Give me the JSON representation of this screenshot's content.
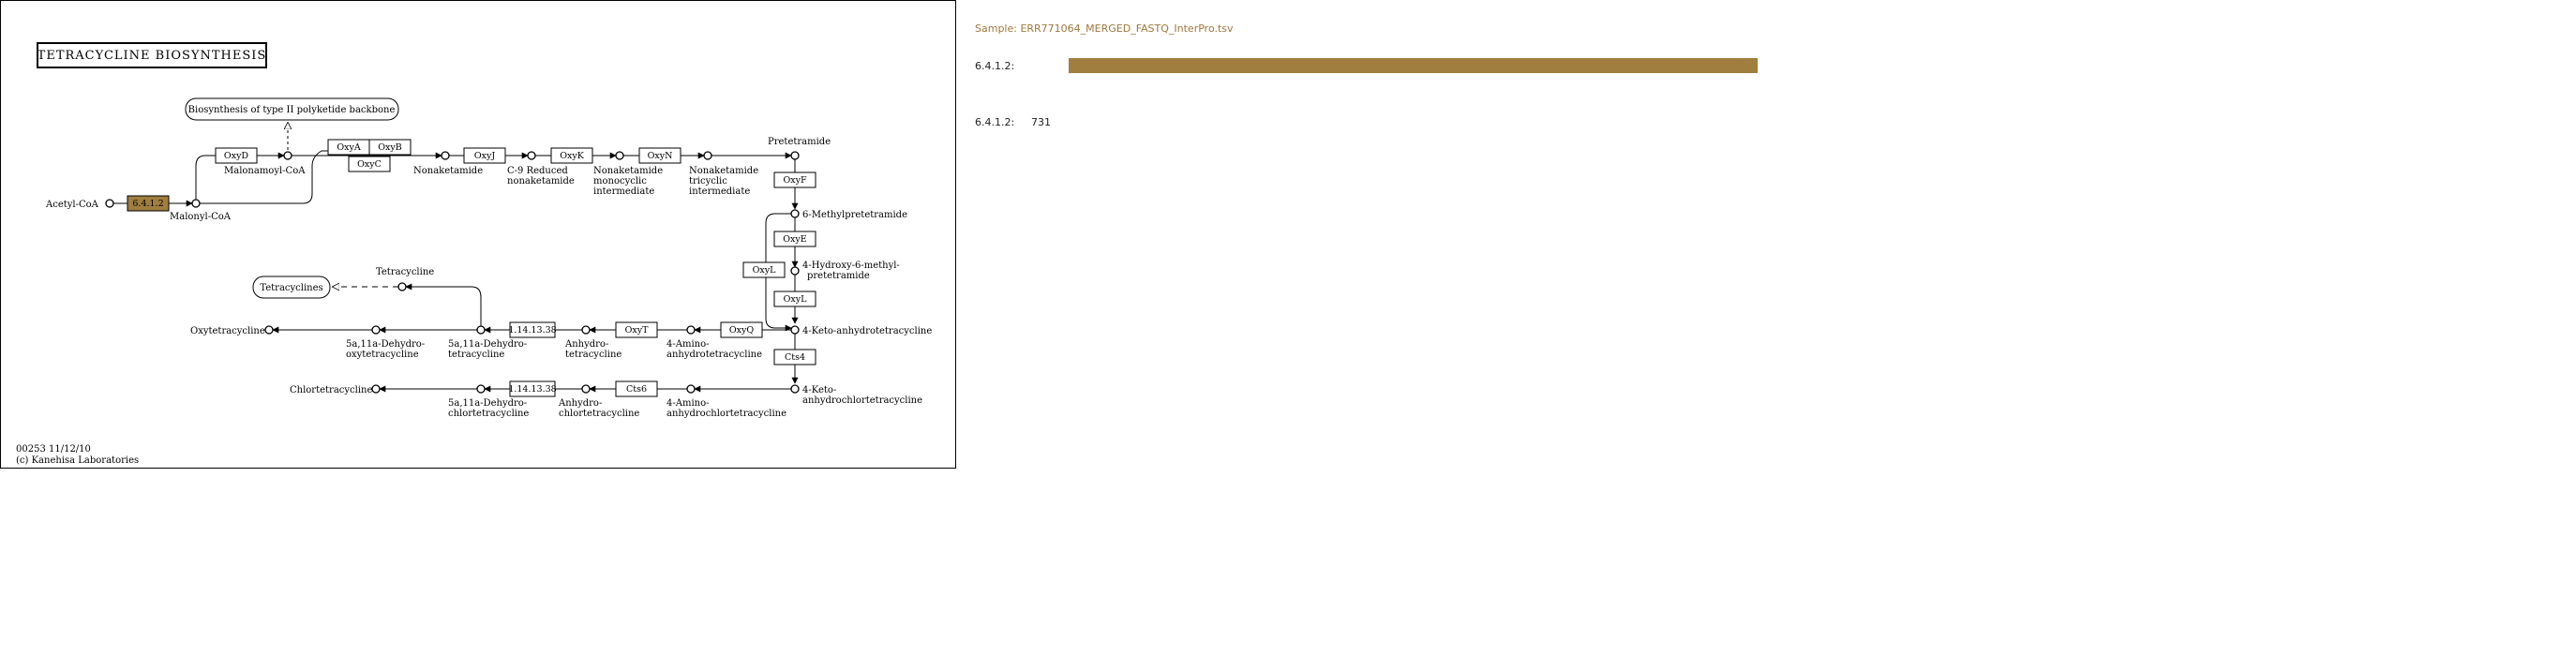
{
  "map": {
    "title": "TETRACYCLINE  BIOSYNTHESIS",
    "footer_id": "00253 11/12/10",
    "footer_copyright": "(c) Kanehisa Laboratories",
    "highlight_color": "#a07e3f",
    "enzymes": {
      "ec_6412": "6.4.1.2",
      "oxyD": "OxyD",
      "oxyA": "OxyA",
      "oxyB": "OxyB",
      "oxyC": "OxyC",
      "oxyJ": "OxyJ",
      "oxyK": "OxyK",
      "oxyN": "OxyN",
      "oxyF": "OxyF",
      "oxyL_1": "OxyL",
      "oxyE": "OxyE",
      "oxyL_2": "OxyL",
      "oxyQ": "OxyQ",
      "oxyT": "OxyT",
      "ec_1141338_a": "1.14.13.38",
      "cts4": "Cts4",
      "cts6": "Cts6",
      "ec_1141338_b": "1.14.13.38"
    },
    "compounds": {
      "acetyl_coa": "Acetyl-CoA",
      "malonyl_coa": "Malonyl-CoA",
      "malonamoyl_coa": "Malonamoyl-CoA",
      "nonaketamide": "Nonaketamide",
      "c9_reduced_1": "C-9 Reduced",
      "c9_reduced_2": "nonaketamide",
      "nk_mono_1": "Nonaketamide",
      "nk_mono_2": "monocyclic",
      "nk_mono_3": "intermediate",
      "nk_tri_1": "Nonaketamide",
      "nk_tri_2": "tricyclic",
      "nk_tri_3": "intermediate",
      "pretetramide": "Pretetramide",
      "methylpretetramide": "6-Methylpretetramide",
      "hydroxy_1": "4-Hydroxy-6-methyl-",
      "hydroxy_2": "pretetramide",
      "keto_anhydro": "4-Keto-anhydrotetracycline",
      "amino_anhydro_1": "4-Amino-",
      "amino_anhydro_2": "anhydrotetracycline",
      "anhydro_1": "Anhydro-",
      "anhydro_2": "tetracycline",
      "dehydro_tc_1": "5a,11a-Dehydro-",
      "dehydro_tc_2": "tetracycline",
      "dehydro_otc_1": "5a,11a-Dehydro-",
      "dehydro_otc_2": "oxytetracycline",
      "oxytetracycline": "Oxytetracycline",
      "tetracycline": "Tetracycline",
      "keto_anhydrochlor_1": "4-Keto-",
      "keto_anhydrochlor_2": "anhydrochlortetracycline",
      "amino_anhydrochlor_1": "4-Amino-",
      "amino_anhydrochlor_2": "anhydrochlortetracycline",
      "anhydrochlor_1": "Anhydro-",
      "anhydrochlor_2": "chlortetracycline",
      "dehydro_ctc_1": "5a,11a-Dehydro-",
      "dehydro_ctc_2": "chlortetracycline",
      "chlortetracycline": "Chlortetracycline"
    },
    "pathways": {
      "polyketide": "Biosynthesis of type II polyketide backbone",
      "tetracyclines": "Tetracyclines"
    }
  },
  "legend": {
    "sample": "Sample: ERR771064_MERGED_FASTQ_InterPro.tsv",
    "bar_label": "6.4.1.2:",
    "bar_fraction": 1.0,
    "bar_color": "#a07e3f",
    "count_label": "6.4.1.2:",
    "count_value": "731"
  }
}
